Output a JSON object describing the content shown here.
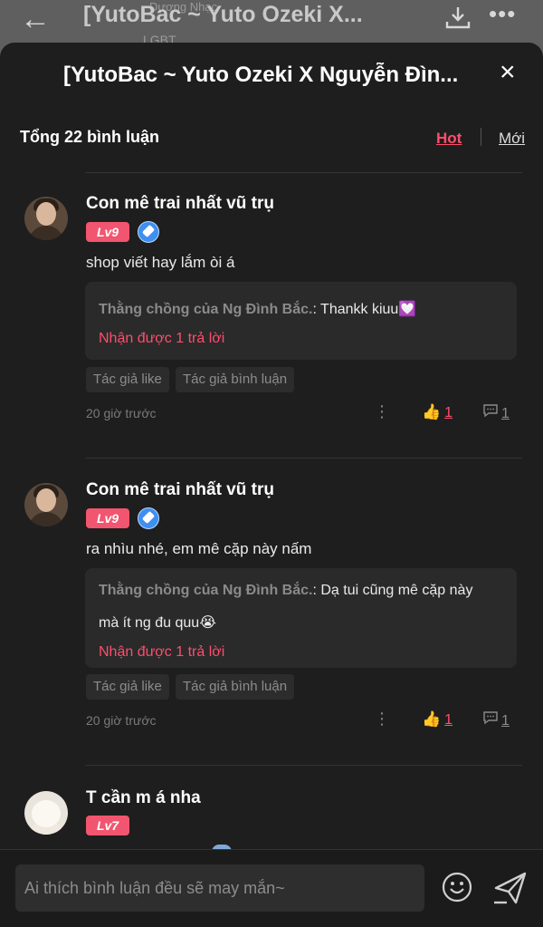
{
  "background": {
    "title": "[YutoBac ~ Yuto Ozeki X...",
    "sub_author": "Dương Nhạc",
    "sub_tag": "LGBT"
  },
  "sheet": {
    "title": "[YutoBac ~ Yuto Ozeki X Nguyễn Đìn...",
    "close_label": "×",
    "count": "Tổng 22 bình luận",
    "sort_hot": "Hot",
    "sort_new": "Mới"
  },
  "comments": [
    {
      "name": "Con mê trai nhất vũ trụ",
      "level": "Lv9",
      "text": "shop viết hay lắm òi á",
      "reply_author": "Thằng chồng của Ng Đình Bắc.",
      "reply_text_1": ": Thankk kiuu💟",
      "reply_text_2": "",
      "reply_more": "Nhận được 1 trả lời",
      "tag_1": "Tác giả like",
      "tag_2": "Tác giả bình luận",
      "time": "20 giờ trước",
      "likes": "1",
      "replies": "1"
    },
    {
      "name": "Con mê trai nhất vũ trụ",
      "level": "Lv9",
      "text": "ra nhìu nhé, em mê cặp này nấm",
      "reply_author": "Thằng chồng của Ng Đình Bắc.",
      "reply_text_1": ": Dạ tui cũng mê cặp này",
      "reply_text_2": "mà ít ng đu quu😭",
      "reply_more": "Nhận được 1 trả lời",
      "tag_1": "Tác giả like",
      "tag_2": "Tác giả bình luận",
      "time": "20 giờ trước",
      "likes": "1",
      "replies": "1"
    },
    {
      "name": "T cần m á nha",
      "level": "Lv7"
    }
  ],
  "input": {
    "placeholder": "Ai thích bình luận đều sẽ may mắn~"
  },
  "colors": {
    "accent": "#ff4d6d",
    "level_badge": "#f2556f",
    "sheet_bg": "#1e1e1e"
  },
  "icons": [
    "back-arrow-icon",
    "download-icon",
    "more-icon",
    "close-icon",
    "verified-badge-icon",
    "more-vertical-icon",
    "thumbs-up-icon",
    "reply-bubble-icon",
    "emoji-icon",
    "send-icon"
  ]
}
